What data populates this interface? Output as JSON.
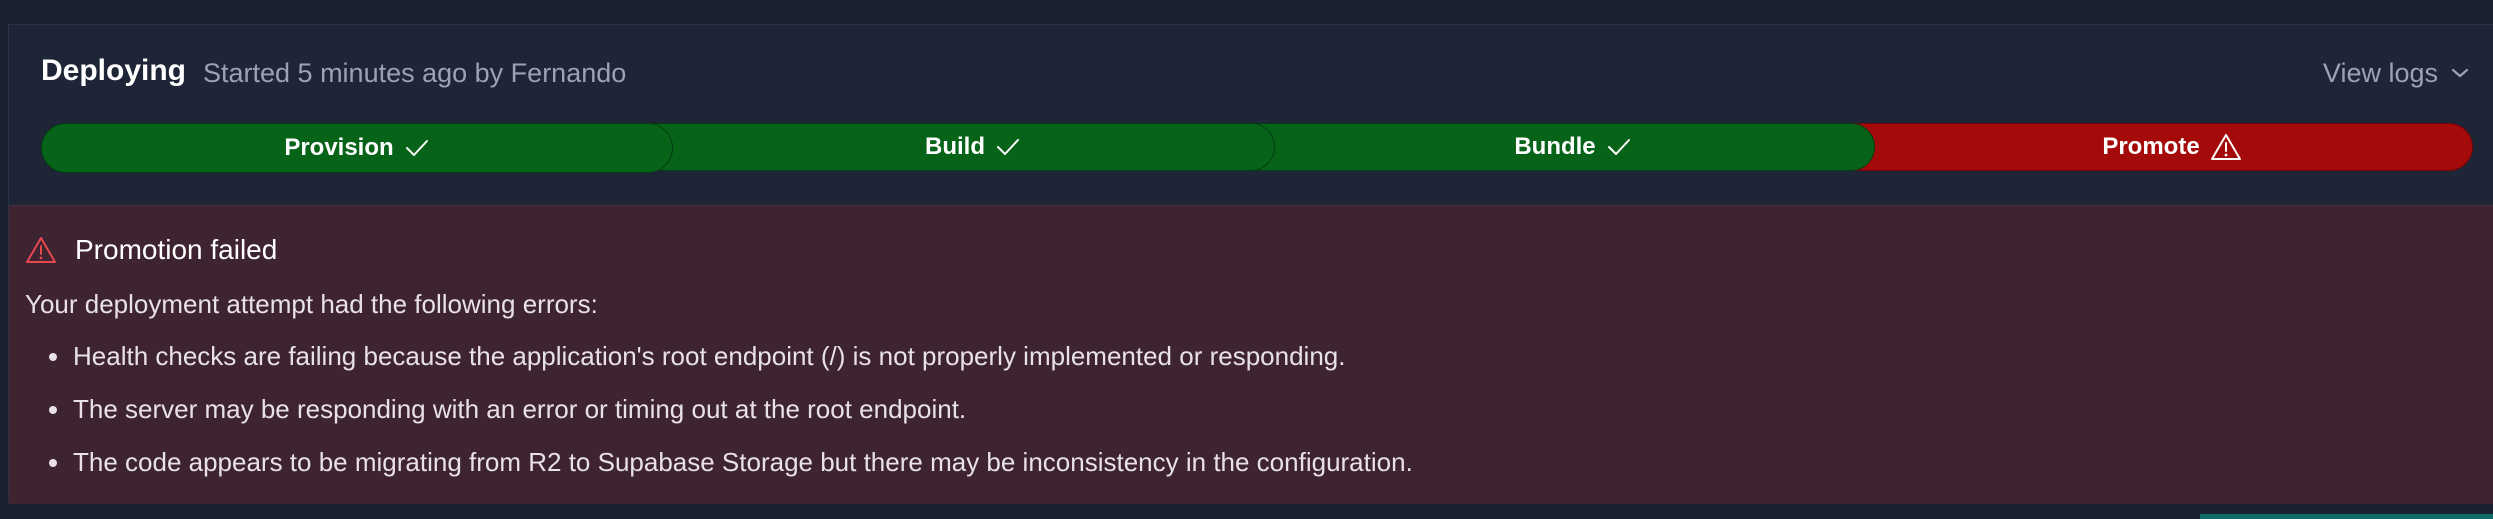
{
  "header": {
    "title": "Deploying",
    "subtitle": "Started 5 minutes ago by Fernando",
    "view_logs_label": "View logs"
  },
  "steps": [
    {
      "label": "Provision",
      "status": "success",
      "icon": "check-icon"
    },
    {
      "label": "Build",
      "status": "success",
      "icon": "check-icon"
    },
    {
      "label": "Bundle",
      "status": "success",
      "icon": "check-icon"
    },
    {
      "label": "Promote",
      "status": "failed",
      "icon": "warning-icon"
    }
  ],
  "error": {
    "title": "Promotion failed",
    "intro": "Your deployment attempt had the following errors:",
    "items": [
      "Health checks are failing because the application's root endpoint (/) is not properly implemented or responding.",
      "The server may be responding with an error or timing out at the root endpoint.",
      "The code appears to be migrating from R2 to Supabase Storage but there may be inconsistency in the configuration."
    ]
  },
  "colors": {
    "success": "#066318",
    "failed": "#a50a0a",
    "error_bg": "#3e2331",
    "panel_bg": "#1e2536",
    "warning_icon": "#e5484d"
  }
}
